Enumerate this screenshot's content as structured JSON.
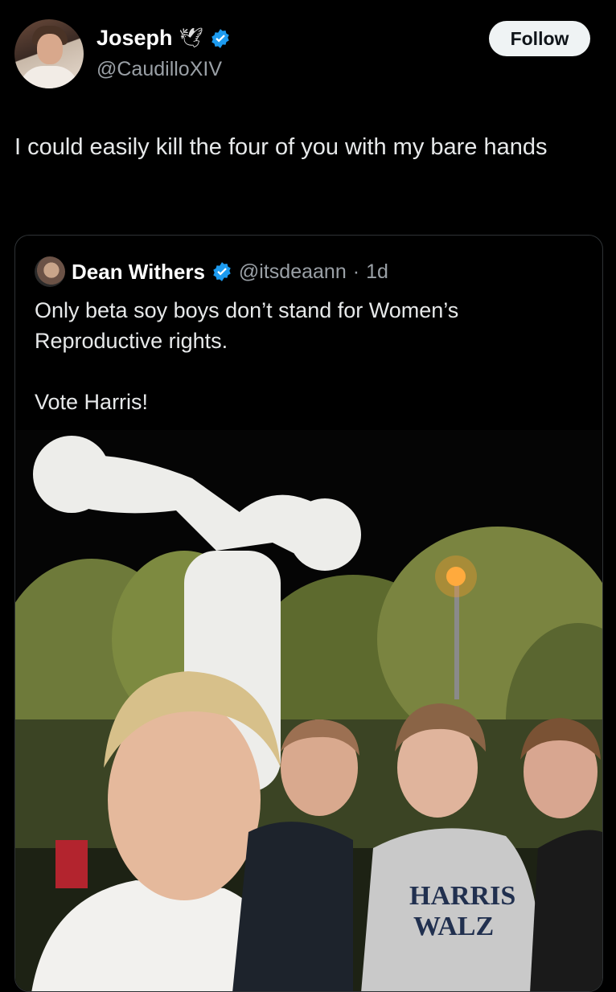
{
  "post": {
    "author_name": "Joseph",
    "author_handle": "@CaudilloXIV",
    "follow_label": "Follow",
    "text": "I could easily kill the four of you with my bare hands"
  },
  "quoted": {
    "author_name": "Dean Withers",
    "author_handle": "@itsdeaann",
    "time": "1d",
    "text": "Only beta soy boys don’t stand for Women’s\nReproductive rights.\n\nVote Harris!"
  },
  "photo": {
    "sweatshirt_text_line1": "HARRIS",
    "sweatshirt_text_line2": "WALZ"
  },
  "colors": {
    "background": "#000000",
    "verified_blue": "#1d9bf0",
    "follow_bg": "#eff3f4",
    "secondary_text": "#9aa0a6"
  }
}
